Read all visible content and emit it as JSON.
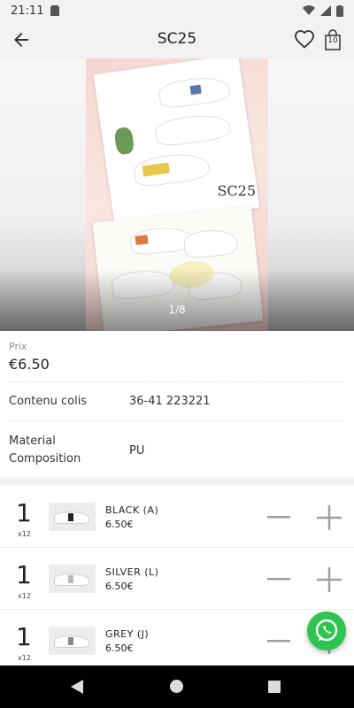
{
  "status_bar": {
    "time": "21:11"
  },
  "header": {
    "title": "SC25",
    "cart_count": "10",
    "icons": [
      "back-arrow-icon",
      "heart-icon",
      "shopping-bag-icon"
    ]
  },
  "gallery": {
    "brand_text": "SC25",
    "pager": "1/8"
  },
  "details": {
    "price_label": "Prix",
    "price_value": "€6.50",
    "rows": [
      {
        "key": "Contenu colis",
        "value": "36-41 223221"
      },
      {
        "key": "Material Composition",
        "value": "PU"
      }
    ]
  },
  "variants": [
    {
      "qty": "1",
      "multiplier": "x12",
      "name": "BLACK (A)",
      "price": "6.50€",
      "stripe_color": "#222222"
    },
    {
      "qty": "1",
      "multiplier": "x12",
      "name": "SILVER (L)",
      "price": "6.50€",
      "stripe_color": "#b9b9b9"
    },
    {
      "qty": "1",
      "multiplier": "x12",
      "name": "GREY (J)",
      "price": "6.50€",
      "stripe_color": "#8a8a8a"
    }
  ],
  "colors": {
    "app_bar_bg": "#f2f2f2",
    "whatsapp_green": "#2dc44f",
    "stepper_grey": "#9e9e9e"
  }
}
